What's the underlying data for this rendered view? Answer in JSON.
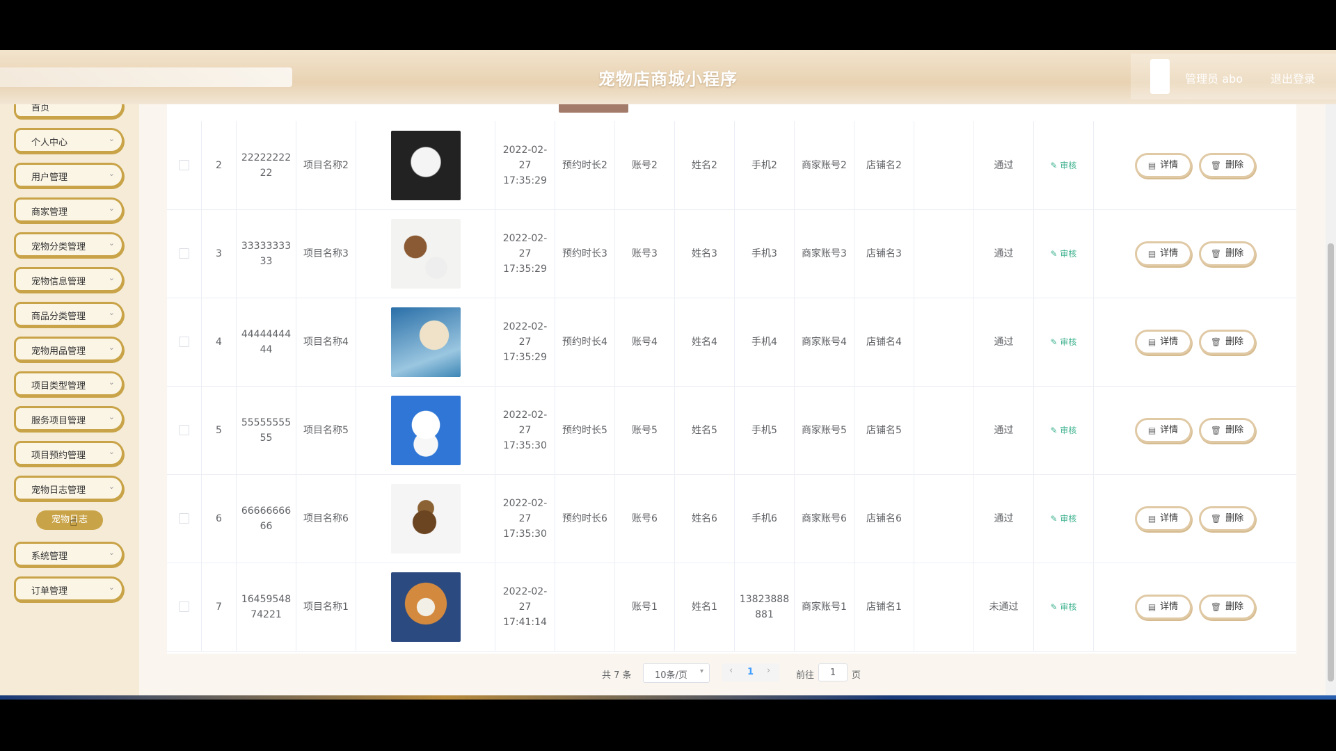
{
  "header": {
    "title": "宠物店商城小程序",
    "admin_label": "管理员 abo",
    "logout": "退出登录"
  },
  "sidebar": {
    "top_item": "首页",
    "items": [
      {
        "label": "个人中心"
      },
      {
        "label": "用户管理"
      },
      {
        "label": "商家管理"
      },
      {
        "label": "宠物分类管理"
      },
      {
        "label": "宠物信息管理"
      },
      {
        "label": "商品分类管理"
      },
      {
        "label": "宠物用品管理"
      },
      {
        "label": "项目类型管理"
      },
      {
        "label": "服务项目管理"
      },
      {
        "label": "项目预约管理"
      },
      {
        "label": "宠物日志管理"
      }
    ],
    "sub_item": "宠物日志",
    "after_items": [
      {
        "label": "系统管理"
      },
      {
        "label": "订单管理"
      }
    ]
  },
  "table": {
    "rows": [
      {
        "idx": "2",
        "no": "2222222222",
        "pname": "项目名称2",
        "date": "2022-02-27 17:35:29",
        "duration": "预约时长2",
        "account": "账号2",
        "name": "姓名2",
        "phone": "手机2",
        "merchant": "商家账号2",
        "shop": "店铺名2",
        "status": "通过",
        "img": "white-poodle-photo"
      },
      {
        "idx": "3",
        "no": "3333333333",
        "pname": "项目名称3",
        "date": "2022-02-27 17:35:29",
        "duration": "预约时长3",
        "account": "账号3",
        "name": "姓名3",
        "phone": "手机3",
        "merchant": "商家账号3",
        "shop": "店铺名3",
        "status": "通过",
        "img": "dog-grooming-photo"
      },
      {
        "idx": "4",
        "no": "4444444444",
        "pname": "项目名称4",
        "date": "2022-02-27 17:35:29",
        "duration": "预约时长4",
        "account": "账号4",
        "name": "姓名4",
        "phone": "手机4",
        "merchant": "商家账号4",
        "shop": "店铺名4",
        "status": "通过",
        "img": "poodle-grooming-photo"
      },
      {
        "idx": "5",
        "no": "5555555555",
        "pname": "项目名称5",
        "date": "2022-02-27 17:35:30",
        "duration": "预约时长5",
        "account": "账号5",
        "name": "姓名5",
        "phone": "手机5",
        "merchant": "商家账号5",
        "shop": "店铺名5",
        "status": "通过",
        "img": "bichon-blue-photo"
      },
      {
        "idx": "6",
        "no": "6666666666",
        "pname": "项目名称6",
        "date": "2022-02-27 17:35:30",
        "duration": "预约时长6",
        "account": "账号6",
        "name": "姓名6",
        "phone": "手机6",
        "merchant": "商家账号6",
        "shop": "店铺名6",
        "status": "通过",
        "img": "yorkie-photo"
      },
      {
        "idx": "7",
        "no": "1645954874221",
        "pname": "项目名称1",
        "date": "2022-02-27 17:41:14",
        "duration": "",
        "account": "账号1",
        "name": "姓名1",
        "phone": "13823888881",
        "merchant": "商家账号1",
        "shop": "店铺名1",
        "status": "未通过",
        "img": "shiba-photo"
      }
    ],
    "audit_label": "审核",
    "detail_label": "详情",
    "delete_label": "删除"
  },
  "pagination": {
    "total": "共 7 条",
    "page_size": "10条/页",
    "current": "1",
    "goto_label": "前往",
    "goto_value": "1",
    "page_suffix": "页"
  },
  "colors": {
    "accent": "#c9a347",
    "audit_green": "#3fb28f",
    "sidebar_bg": "#f5ebd6"
  }
}
